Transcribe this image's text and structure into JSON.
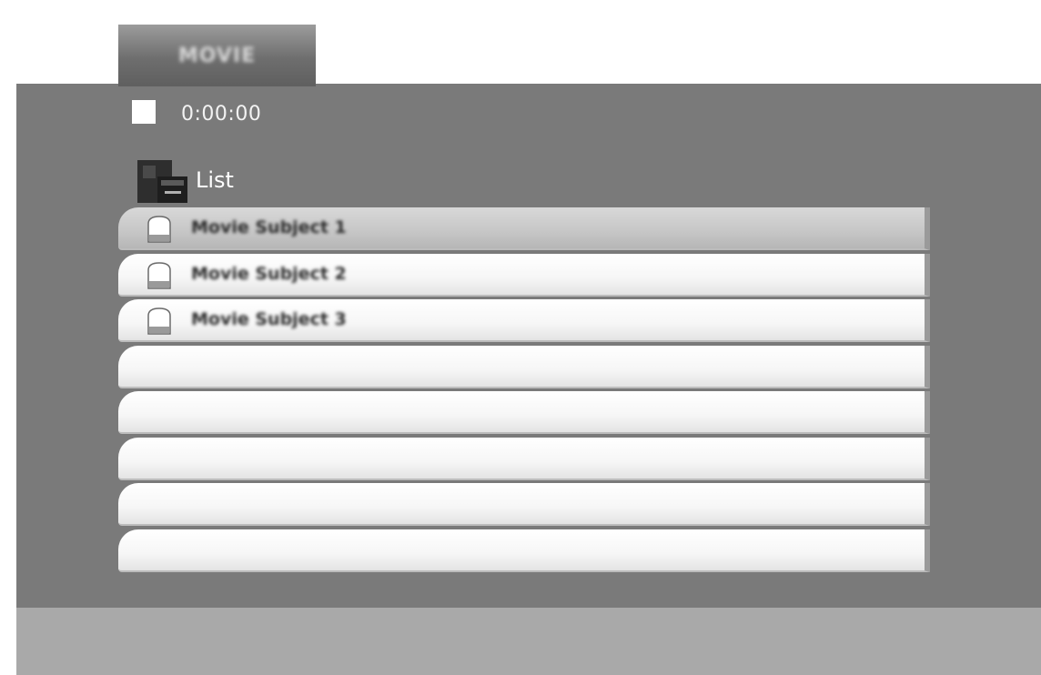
{
  "menu": {
    "tab_label": "MOVIE"
  },
  "status": {
    "time": "0:00:00"
  },
  "list": {
    "title": "List",
    "items": [
      {
        "label": "Movie Subject 1",
        "selected": true
      },
      {
        "label": "Movie Subject 2",
        "selected": false
      },
      {
        "label": "Movie Subject 3",
        "selected": false
      },
      {
        "label": "",
        "selected": false
      },
      {
        "label": "",
        "selected": false
      },
      {
        "label": "",
        "selected": false
      },
      {
        "label": "",
        "selected": false
      },
      {
        "label": "",
        "selected": false
      }
    ]
  },
  "icons": {
    "playback": "stop-icon",
    "list": "folder-icon",
    "item": "file-icon"
  },
  "colors": {
    "panel": "#7a7a7a",
    "row": "#f6f6f6",
    "row_selected": "#c6c6c6",
    "bottom_band": "#a9a9a9"
  }
}
